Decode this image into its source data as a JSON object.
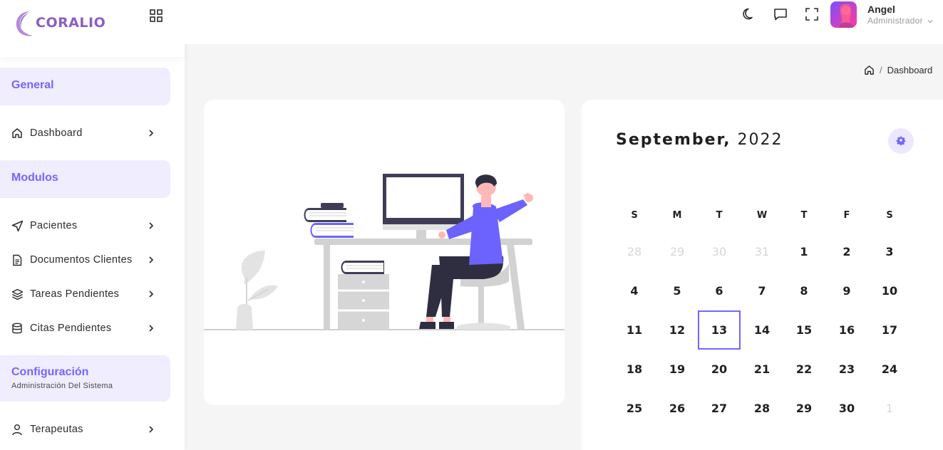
{
  "brand": {
    "name": "CORALIO",
    "color": "#8a5fbf"
  },
  "accent": "#7366ff",
  "sidebar": {
    "sections": [
      {
        "title": "General"
      },
      {
        "title": "Modulos"
      },
      {
        "title": "Configuración",
        "subtitle": "Administración Del Sistema"
      }
    ],
    "items": [
      {
        "label": "Dashboard",
        "icon": "home-icon"
      },
      {
        "label": "Pacientes",
        "icon": "send-icon"
      },
      {
        "label": "Documentos Clientes",
        "icon": "file-icon"
      },
      {
        "label": "Tareas Pendientes",
        "icon": "layers-icon"
      },
      {
        "label": "Citas Pendientes",
        "icon": "database-icon"
      },
      {
        "label": "Terapeutas",
        "icon": "user-icon"
      }
    ]
  },
  "header": {
    "icons": [
      "moon-icon",
      "chat-icon",
      "fullscreen-icon"
    ],
    "user": {
      "name": "Angel",
      "role": "Administrador"
    }
  },
  "breadcrumb": {
    "home_icon": "home-icon",
    "separator": "/",
    "current": "Dashboard"
  },
  "calendar": {
    "month": "September,",
    "year": "2022",
    "weekdays": [
      "S",
      "M",
      "T",
      "W",
      "T",
      "F",
      "S"
    ],
    "weeks": [
      [
        "28",
        "29",
        "30",
        "31",
        "1",
        "2",
        "3"
      ],
      [
        "4",
        "5",
        "6",
        "7",
        "8",
        "9",
        "10"
      ],
      [
        "11",
        "12",
        "13",
        "14",
        "15",
        "16",
        "17"
      ],
      [
        "18",
        "19",
        "20",
        "21",
        "22",
        "23",
        "24"
      ],
      [
        "25",
        "26",
        "27",
        "28",
        "29",
        "30",
        "1"
      ]
    ],
    "muted": [
      [
        0,
        0
      ],
      [
        0,
        1
      ],
      [
        0,
        2
      ],
      [
        0,
        3
      ],
      [
        4,
        6
      ]
    ],
    "today": [
      2,
      2
    ],
    "settings_icon": "gear-icon"
  }
}
